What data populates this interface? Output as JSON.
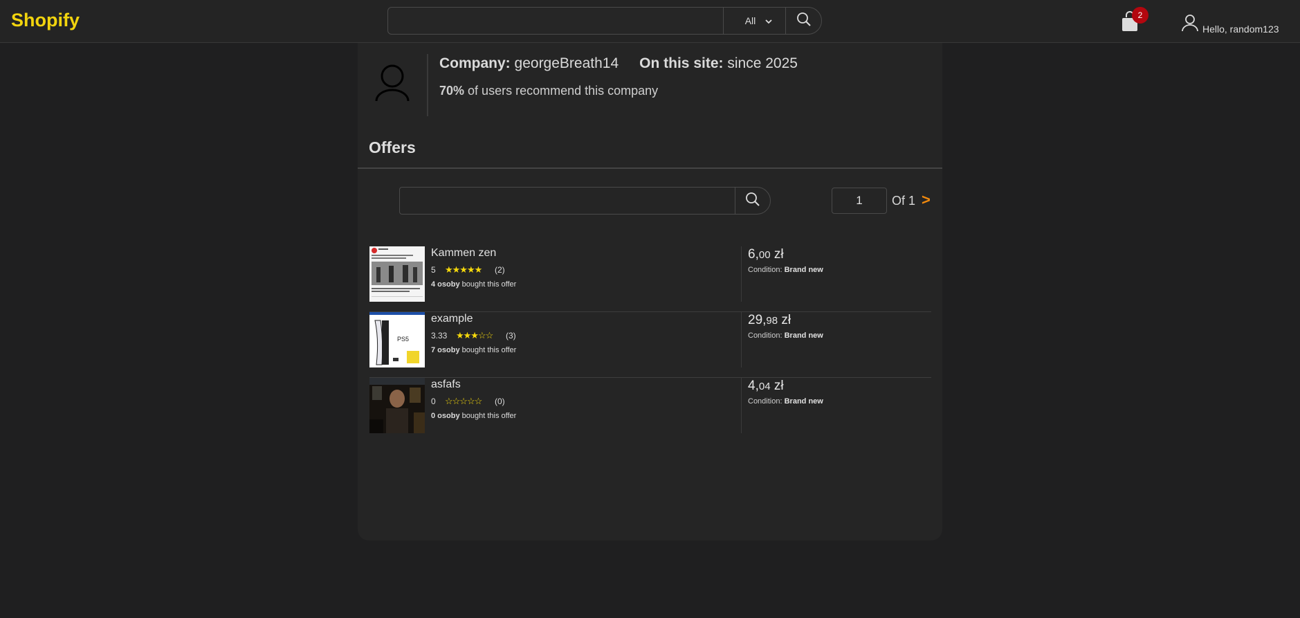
{
  "header": {
    "logo": "Shopify",
    "search": {
      "value": "",
      "placeholder": ""
    },
    "category": "All",
    "cart_count": "2",
    "user_greeting": "Hello, random123"
  },
  "company": {
    "company_label": "Company:",
    "company_name": "georgeBreath14",
    "site_label": "On this site:",
    "site_value": "since 2025",
    "recommend_pct": "70%",
    "recommend_text": "of users recommend this company"
  },
  "offers": {
    "title": "Offers",
    "search": {
      "value": "",
      "placeholder": ""
    },
    "page": "1",
    "of_label": "Of 1",
    "next_label": ">",
    "items": [
      {
        "name": "Kammen zen",
        "rating": "5",
        "stars": "★★★★★",
        "reviews": "(2)",
        "bought_count": "4 osoby",
        "bought_text": "bought this offer",
        "price_main": "6,",
        "price_cents": "00",
        "price_currency": "zł",
        "condition_label": "Condition:",
        "condition_value": "Brand new"
      },
      {
        "name": "example",
        "rating": "3.33",
        "stars": "★★★☆☆",
        "reviews": "(3)",
        "bought_count": "7 osoby",
        "bought_text": "bought this offer",
        "price_main": "29,",
        "price_cents": "98",
        "price_currency": "zł",
        "condition_label": "Condition:",
        "condition_value": "Brand new"
      },
      {
        "name": "asfafs",
        "rating": "0",
        "stars": "☆☆☆☆☆",
        "reviews": "(0)",
        "bought_count": "0 osoby",
        "bought_text": "bought this offer",
        "price_main": "4,",
        "price_cents": "04",
        "price_currency": "zł",
        "condition_label": "Condition:",
        "condition_value": "Brand new"
      }
    ]
  },
  "colors": {
    "brand": "#f2d40e",
    "accent": "#f0890e",
    "badge": "#b3070f",
    "star": "#f6d90c"
  },
  "icons": [
    "search-icon",
    "chevron-down-icon",
    "shopping-bag-icon",
    "user-icon",
    "company-avatar-icon"
  ]
}
